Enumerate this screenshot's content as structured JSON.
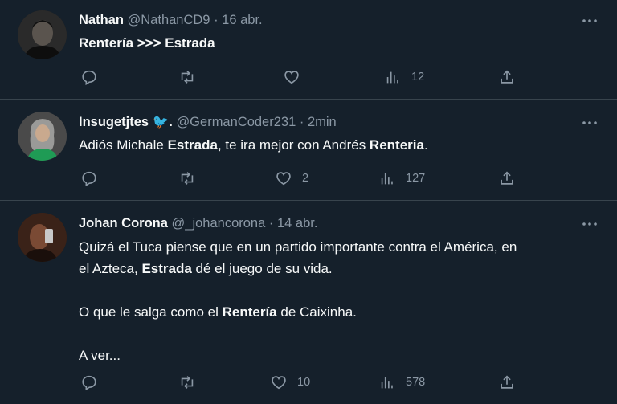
{
  "tweets": [
    {
      "name": "Nathan",
      "handle": "@NathanCD9",
      "dot": "·",
      "time": "16 abr.",
      "text_parts": [
        {
          "t": "Rentería >>> Estrada",
          "b": true
        }
      ],
      "reply_count": "",
      "retweet_count": "",
      "like_count": "",
      "views_count": "12"
    },
    {
      "name": "Insugetjtes",
      "verified_emoji": "🐦.",
      "handle": "@GermanCoder231",
      "dot": "·",
      "time": "2min",
      "text_parts": [
        {
          "t": "Adiós Michale ",
          "b": false
        },
        {
          "t": "Estrada",
          "b": true
        },
        {
          "t": ", te ira mejor con Andrés ",
          "b": false
        },
        {
          "t": "Renteria",
          "b": true
        },
        {
          "t": ".",
          "b": false
        }
      ],
      "reply_count": "",
      "retweet_count": "",
      "like_count": "2",
      "views_count": "127"
    },
    {
      "name": "Johan Corona",
      "handle": "@_johancorona",
      "dot": "·",
      "time": "14 abr.",
      "line1": "Quizá el Tuca piense que en un partido importante contra el América, en",
      "line2_pre": "el Azteca, ",
      "line2_bold": "Estrada",
      "line2_post": " dé el juego de su vida.",
      "line3_pre": "O que le salga como el ",
      "line3_bold": "Rentería",
      "line3_post": " de Caixinha.",
      "line4": "A ver...",
      "reply_count": "",
      "retweet_count": "",
      "like_count": "10",
      "views_count": "578"
    }
  ],
  "icons": {
    "reply": "reply-icon",
    "retweet": "retweet-icon",
    "like": "heart-icon",
    "views": "views-icon",
    "share": "share-icon",
    "more": "more-icon"
  },
  "colors": {
    "background": "#15202b",
    "text": "#f7f9f9",
    "secondary": "#8b98a5",
    "separator": "#38444d"
  }
}
